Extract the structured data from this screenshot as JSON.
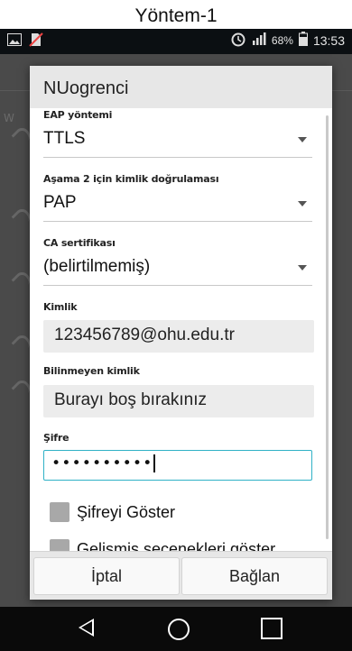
{
  "caption": "Yöntem-1",
  "statusbar": {
    "battery": "68%",
    "time": "13:53",
    "icons": [
      "image-icon",
      "no-sim-icon",
      "alarm-icon",
      "signal-icon",
      "battery-icon"
    ]
  },
  "backdrop": {
    "edge_text": "W"
  },
  "dialog": {
    "title": "NUogrenci",
    "eap_label": "EAP yöntemi",
    "eap_value": "TTLS",
    "phase2_label": "Aşama 2 için kimlik doğrulaması",
    "phase2_value": "PAP",
    "ca_label": "CA sertifikası",
    "ca_value": "(belirtilmemiş)",
    "identity_label": "Kimlik",
    "identity_value": "123456789@ohu.edu.tr",
    "anon_label": "Bilinmeyen kimlik",
    "anon_value": "Burayı boş bırakınız",
    "password_label": "Şifre",
    "password_value": "••••••••••",
    "show_password": "Şifreyi Göster",
    "advanced": "Gelişmiş seçenekleri göster",
    "cancel": "İptal",
    "connect": "Bağlan"
  }
}
